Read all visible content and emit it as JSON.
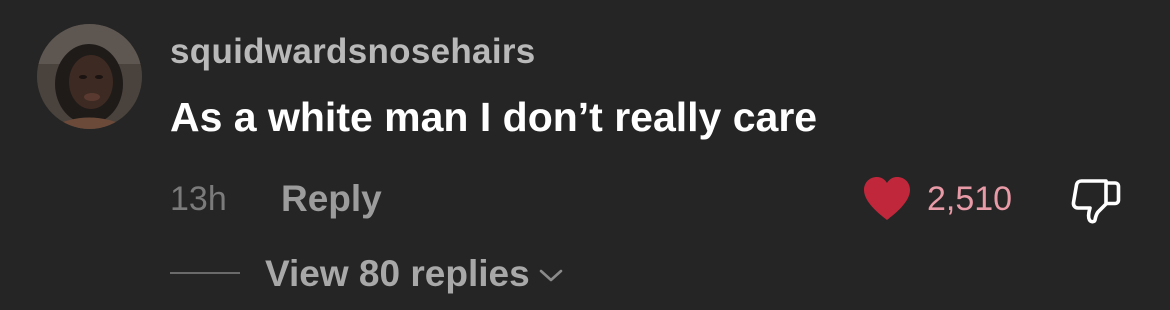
{
  "comment": {
    "username": "squidwardsnosehairs",
    "text": "As a white man I don’t really care",
    "timestamp": "13h",
    "reply_label": "Reply",
    "like_count": "2,510",
    "liked": true,
    "view_replies_label": "View 80 replies"
  },
  "icons": {
    "avatar": "avatar",
    "like": "heart-icon",
    "dislike": "thumbs-down-icon",
    "expand": "chevron-down-icon"
  },
  "colors": {
    "background": "#252525",
    "username": "#b9b9b9",
    "text": "#ffffff",
    "meta": "#7b7b7b",
    "heart": "#c1273b",
    "like_count": "#e89aa7"
  }
}
